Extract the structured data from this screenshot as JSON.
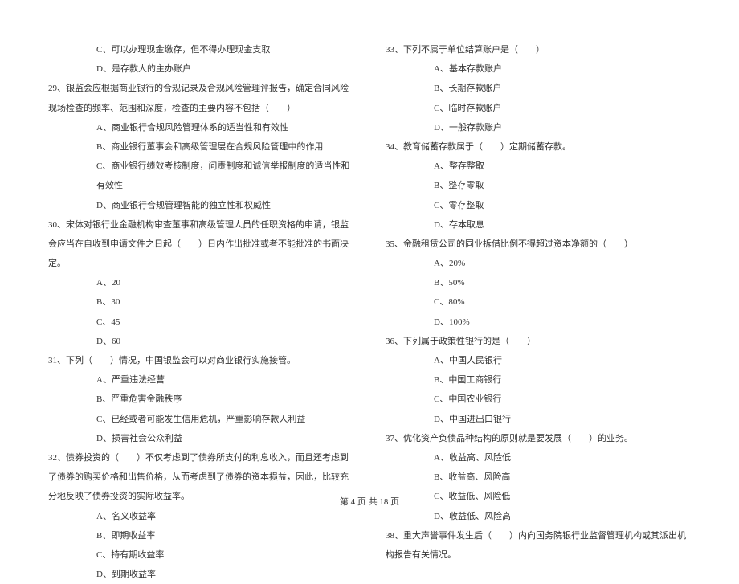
{
  "left": {
    "q28_optC": "C、可以办理现金缴存，但不得办理现金支取",
    "q28_optD": "D、是存款人的主办账户",
    "q29_text": "29、银监会应根据商业银行的合规记录及合规风险管理评报告，确定合同风险现场检查的频率、范围和深度，检查的主要内容不包括（　　）",
    "q29_optA": "A、商业银行合规风险管理体系的适当性和有效性",
    "q29_optB": "B、商业银行董事会和高级管理层在合规风险管理中的作用",
    "q29_optC": "C、商业银行绩效考核制度，问责制度和诚信举报制度的适当性和有效性",
    "q29_optD": "D、商业银行合规管理智能的独立性和权威性",
    "q30_text": "30、宋体对银行业金融机构审查董事和高级管理人员的任职资格的申请，银监会应当在自收到申请文件之日起（　　）日内作出批准或者不能批准的书面决定。",
    "q30_optA": "A、20",
    "q30_optB": "B、30",
    "q30_optC": "C、45",
    "q30_optD": "D、60",
    "q31_text": "31、下列（　　）情况，中国银监会可以对商业银行实施接管。",
    "q31_optA": "A、严重违法经营",
    "q31_optB": "B、严重危害金融秩序",
    "q31_optC": "C、已经或者可能发生信用危机，严重影响存款人利益",
    "q31_optD": "D、损害社会公众利益",
    "q32_text": "32、债券投资的（　　）不仅考虑到了债券所支付的利息收入，而且还考虑到了债券的购买价格和出售价格，从而考虑到了债券的资本损益，因此，比较充分地反映了债券投资的实际收益率。",
    "q32_optA": "A、名义收益率",
    "q32_optB": "B、即期收益率",
    "q32_optC": "C、持有期收益率",
    "q32_optD": "D、到期收益率"
  },
  "right": {
    "q33_text": "33、下列不属于单位结算账户是（　　）",
    "q33_optA": "A、基本存款账户",
    "q33_optB": "B、长期存款账户",
    "q33_optC": "C、临时存款账户",
    "q33_optD": "D、一般存款账户",
    "q34_text": "34、教育储蓄存款属于（　　）定期储蓄存款。",
    "q34_optA": "A、整存整取",
    "q34_optB": "B、整存零取",
    "q34_optC": "C、零存整取",
    "q34_optD": "D、存本取息",
    "q35_text": "35、金融租赁公司的同业拆借比例不得超过资本净额的（　　）",
    "q35_optA": "A、20%",
    "q35_optB": "B、50%",
    "q35_optC": "C、80%",
    "q35_optD": "D、100%",
    "q36_text": "36、下列属于政策性银行的是（　　）",
    "q36_optA": "A、中国人民银行",
    "q36_optB": "B、中国工商银行",
    "q36_optC": "C、中国农业银行",
    "q36_optD": "D、中国进出口银行",
    "q37_text": "37、优化资产负债品种结构的原则就是要发展（　　）的业务。",
    "q37_optA": "A、收益高、风险低",
    "q37_optB": "B、收益高、风险高",
    "q37_optC": "C、收益低、风险低",
    "q37_optD": "D、收益低、风险高",
    "q38_text": "38、重大声誉事件发生后（　　）内向国务院银行业监督管理机构或其派出机构报告有关情况。"
  },
  "footer": "第 4 页 共 18 页"
}
